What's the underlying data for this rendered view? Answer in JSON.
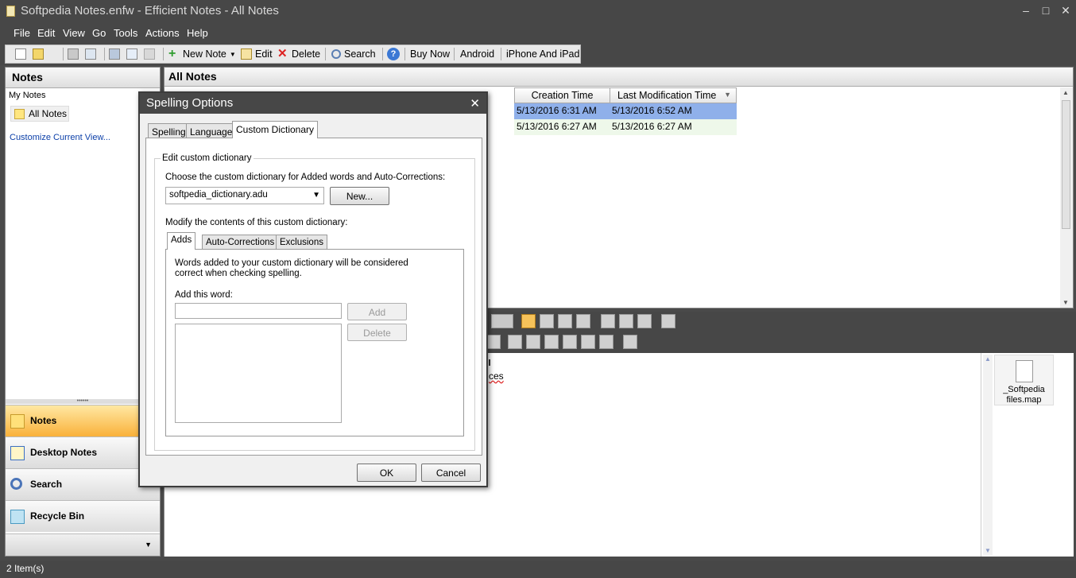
{
  "window": {
    "title": "Softpedia Notes.enfw - Efficient Notes - All Notes",
    "minimize": "–",
    "restore": "□",
    "close": "✕"
  },
  "menu": [
    "File",
    "Edit",
    "View",
    "Go",
    "Tools",
    "Actions",
    "Help"
  ],
  "toolbar": {
    "new_note": "New Note",
    "edit": "Edit",
    "delete": "Delete",
    "search": "Search",
    "buy_now": "Buy Now",
    "android": "Android",
    "iphone": "iPhone And iPad"
  },
  "left_panel": {
    "title": "Notes",
    "section": "My Notes",
    "folder": "All Notes",
    "customize": "Customize Current View...",
    "nav": [
      "Notes",
      "Desktop Notes",
      "Search",
      "Recycle Bin"
    ]
  },
  "main": {
    "title": "All Notes",
    "columns": [
      "Creation Time",
      "Last Modification Time"
    ],
    "rows": [
      {
        "created": "5/13/2016 6:31 AM",
        "modified": "5/13/2016 6:52 AM"
      },
      {
        "created": "5/13/2016 6:27 AM",
        "modified": "5/13/2016 6:27 AM"
      }
    ]
  },
  "editor": {
    "fragment": "ces"
  },
  "attachment": {
    "name": "_Softpedia files.map"
  },
  "status": "2 Item(s)",
  "dialog": {
    "title": "Spelling Options",
    "close": "✕",
    "tabs": [
      "Spelling",
      "Language",
      "Custom Dictionary"
    ],
    "group_label": "Edit custom dictionary",
    "choose_label": "Choose the custom dictionary for Added words and Auto-Corrections:",
    "dictionary": "softpedia_dictionary.adu",
    "new_button": "New...",
    "modify_label": "Modify the contents of this custom dictionary:",
    "subtabs": [
      "Adds",
      "Auto-Corrections",
      "Exclusions"
    ],
    "adds_desc_1": "Words added to your custom dictionary will be considered",
    "adds_desc_2": "correct when checking spelling.",
    "add_word_label": "Add this word:",
    "add_button": "Add",
    "delete_button": "Delete",
    "ok": "OK",
    "cancel": "Cancel"
  }
}
